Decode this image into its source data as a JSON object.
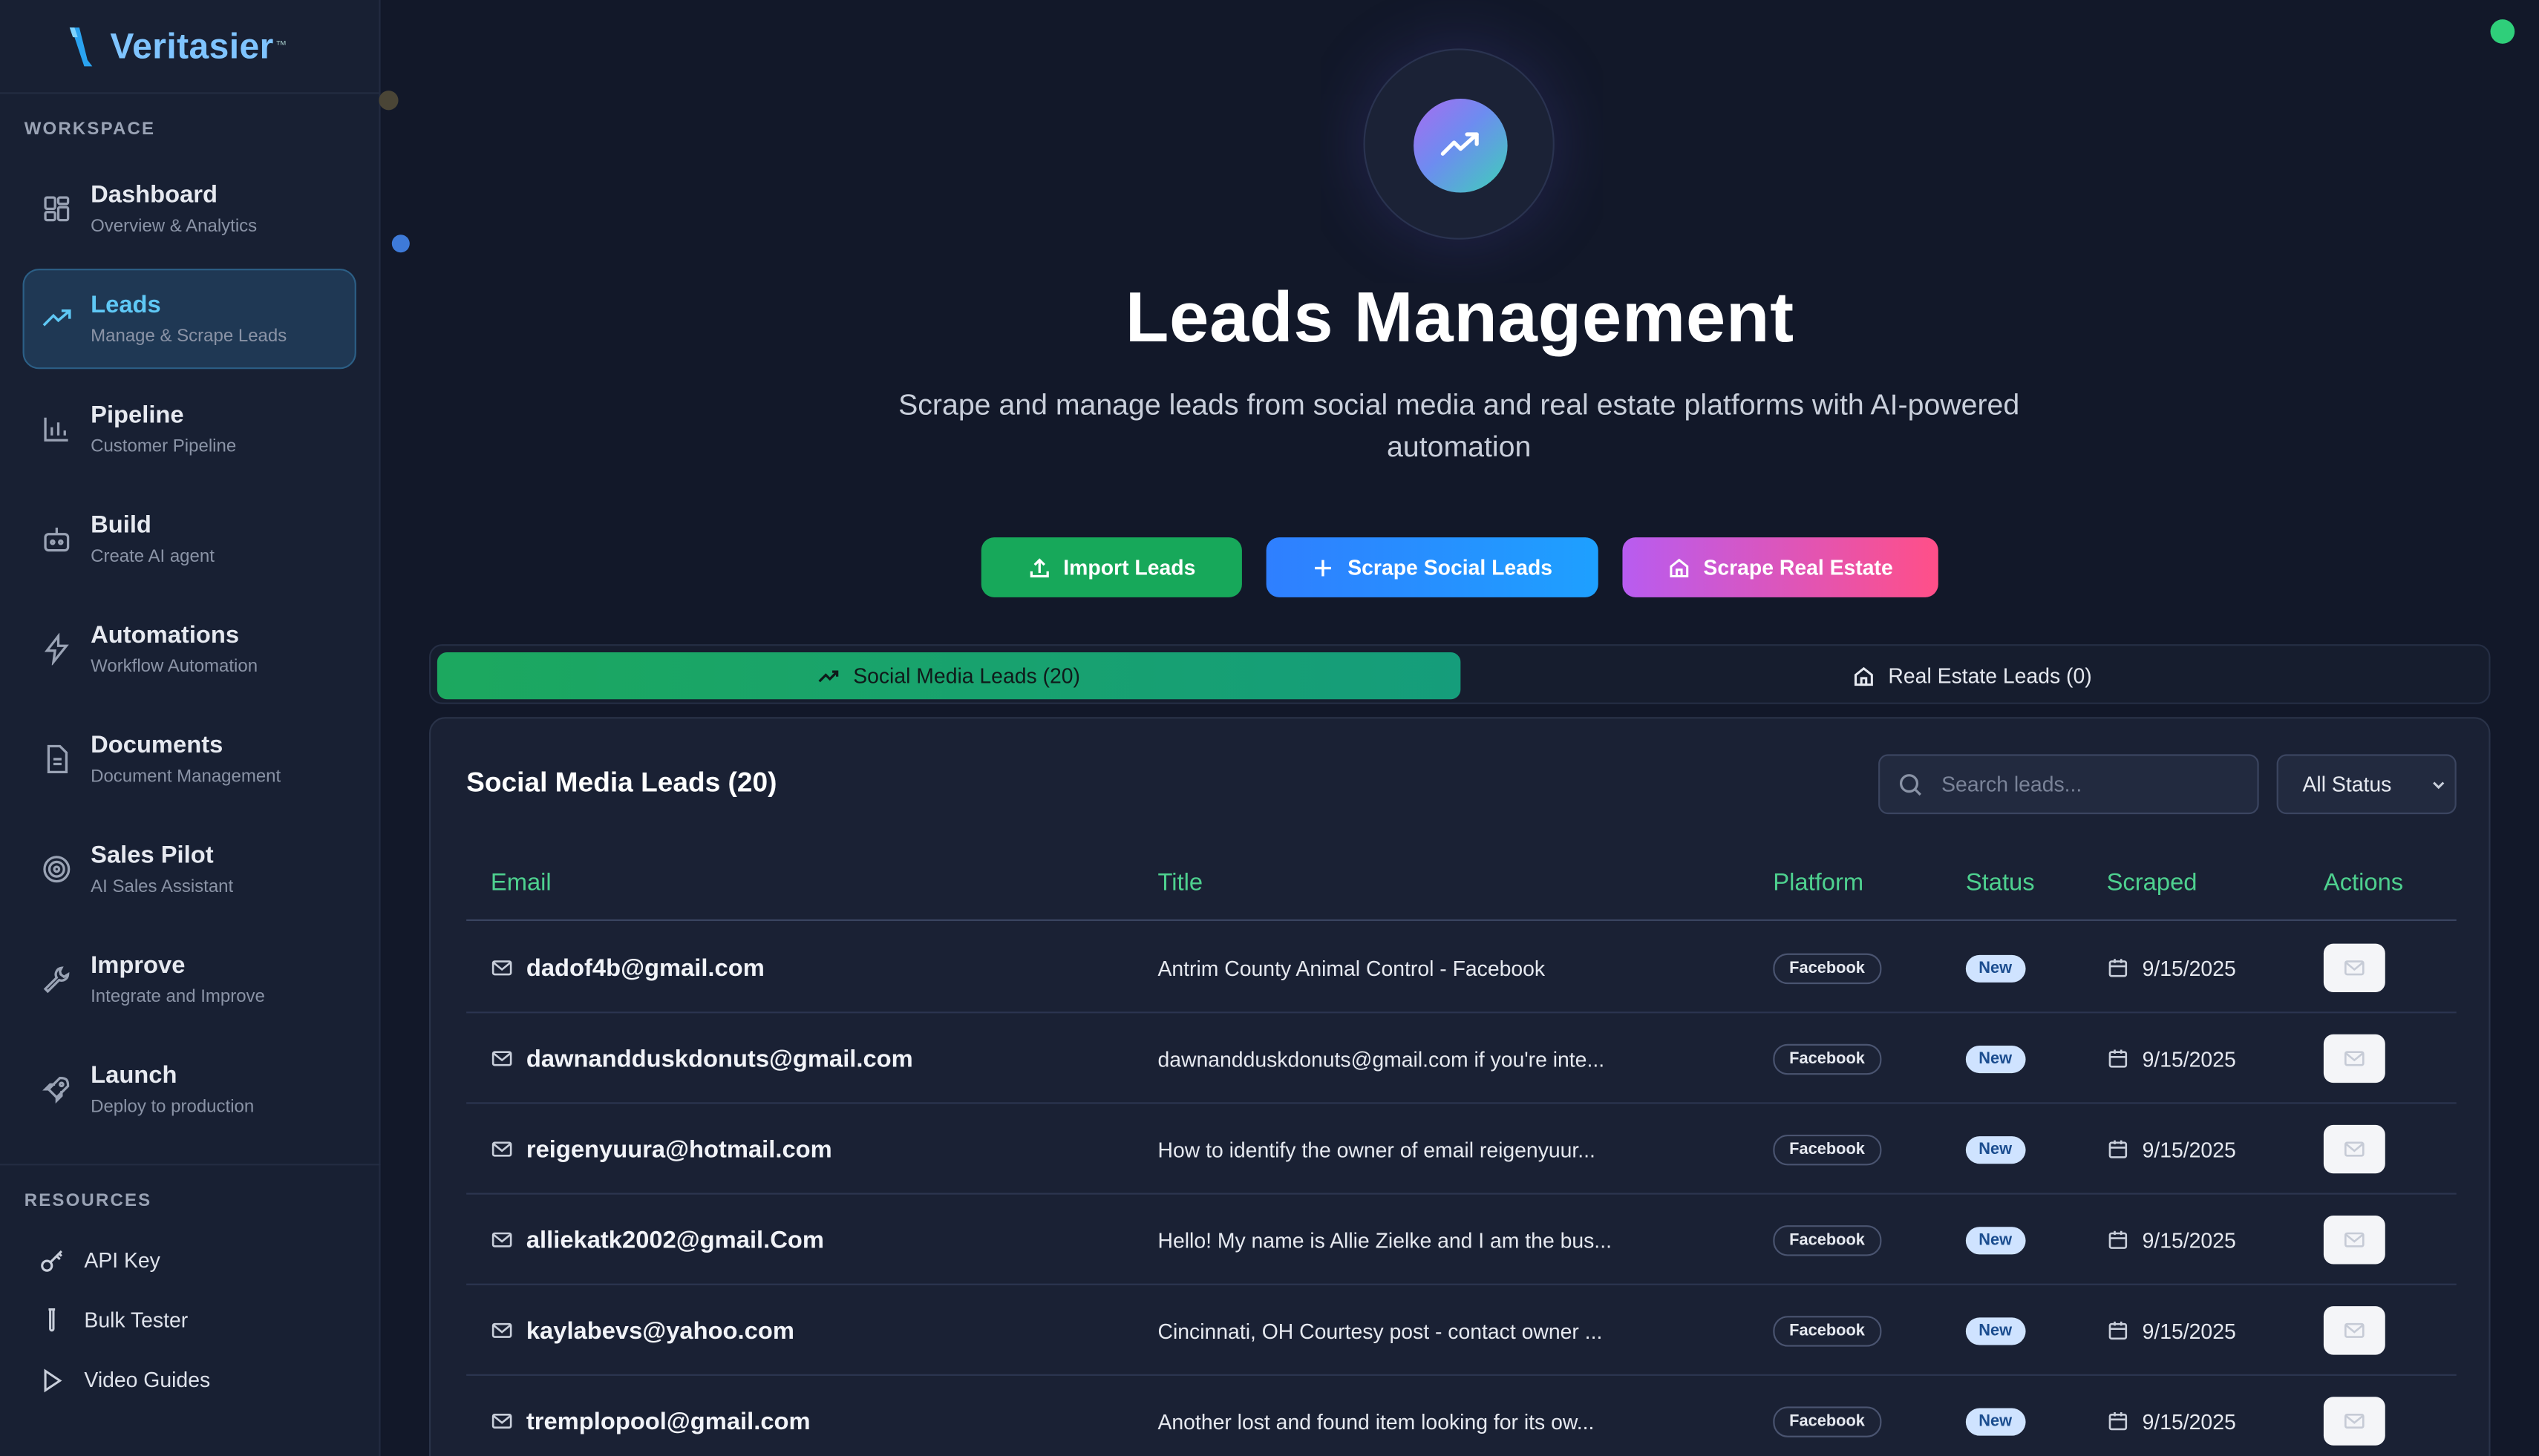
{
  "brand": {
    "name": "Veritasier",
    "tm": "™"
  },
  "sidebar": {
    "workspace_label": "WORKSPACE",
    "items": [
      {
        "title": "Dashboard",
        "subtitle": "Overview & Analytics",
        "icon": "grid-icon",
        "active": false
      },
      {
        "title": "Leads",
        "subtitle": "Manage & Scrape Leads",
        "icon": "trending-icon",
        "active": true
      },
      {
        "title": "Pipeline",
        "subtitle": "Customer Pipeline",
        "icon": "bar-chart-icon",
        "active": false
      },
      {
        "title": "Build",
        "subtitle": "Create AI agent",
        "icon": "bot-icon",
        "active": false
      },
      {
        "title": "Automations",
        "subtitle": "Workflow Automation",
        "icon": "bolt-icon",
        "active": false
      },
      {
        "title": "Documents",
        "subtitle": "Document Management",
        "icon": "document-icon",
        "active": false
      },
      {
        "title": "Sales Pilot",
        "subtitle": "AI Sales Assistant",
        "icon": "target-icon",
        "active": false
      },
      {
        "title": "Improve",
        "subtitle": "Integrate and Improve",
        "icon": "wrench-icon",
        "active": false
      },
      {
        "title": "Launch",
        "subtitle": "Deploy to production",
        "icon": "rocket-icon",
        "active": false
      }
    ],
    "resources_label": "RESOURCES",
    "resources": [
      {
        "label": "API Key",
        "icon": "key-icon"
      },
      {
        "label": "Bulk Tester",
        "icon": "test-tube-icon"
      },
      {
        "label": "Video Guides",
        "icon": "play-icon"
      }
    ]
  },
  "hero": {
    "title": "Leads Management",
    "subtitle": "Scrape and manage leads from social media and real estate platforms with AI-powered automation"
  },
  "buttons": {
    "import": "Import Leads",
    "scrape_social": "Scrape Social Leads",
    "scrape_realestate": "Scrape Real Estate"
  },
  "tabs": {
    "social": "Social Media Leads (20)",
    "realestate": "Real Estate Leads (0)"
  },
  "panel": {
    "title": "Social Media Leads (20)",
    "search_placeholder": "Search leads...",
    "status_filter": "All Status"
  },
  "table": {
    "headers": [
      "Email",
      "Title",
      "Platform",
      "Status",
      "Scraped",
      "Actions"
    ],
    "rows": [
      {
        "email": "dadof4b@gmail.com",
        "title": "Antrim County Animal Control - Facebook",
        "platform": "Facebook",
        "status": "New",
        "scraped": "9/15/2025"
      },
      {
        "email": "dawnandduskdonuts@gmail.com",
        "title": "dawnandduskdonuts@gmail.com if you're inte...",
        "platform": "Facebook",
        "status": "New",
        "scraped": "9/15/2025"
      },
      {
        "email": "reigenyuura@hotmail.com",
        "title": "How to identify the owner of email reigenyuur...",
        "platform": "Facebook",
        "status": "New",
        "scraped": "9/15/2025"
      },
      {
        "email": "alliekatk2002@gmail.Com",
        "title": "Hello! My name is Allie Zielke and I am the bus...",
        "platform": "Facebook",
        "status": "New",
        "scraped": "9/15/2025"
      },
      {
        "email": "kaylabevs@yahoo.com",
        "title": "Cincinnati, OH Courtesy post - contact owner ...",
        "platform": "Facebook",
        "status": "New",
        "scraped": "9/15/2025"
      },
      {
        "email": "tremplopool@gmail.com",
        "title": "Another lost and found item looking for its ow...",
        "platform": "Facebook",
        "status": "New",
        "scraped": "9/15/2025"
      }
    ]
  },
  "colors": {
    "accent_green": "#17a85a",
    "accent_blue": "#2f7fff",
    "accent_pink": "#ff4f88",
    "header_green": "#4ed18f"
  }
}
